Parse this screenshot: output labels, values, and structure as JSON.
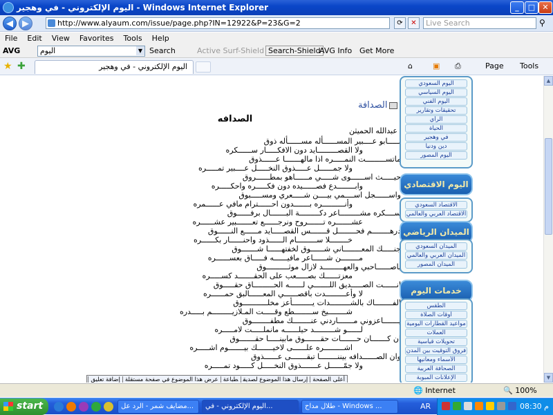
{
  "window": {
    "title": "اليوم الإلكتروني - في وهجير - Windows Internet Explorer",
    "min": "_",
    "max": "□",
    "close": "✕"
  },
  "address": {
    "back": "◀",
    "forward": "▶",
    "url": "http://www.alyaum.com/issue/page.php?IN=12922&P=23&G=2",
    "refresh": "⟳",
    "stop": "✕",
    "live_search_placeholder": "Live Search"
  },
  "menu": {
    "items": [
      "File",
      "Edit",
      "View",
      "Favorites",
      "Tools",
      "Help"
    ]
  },
  "avg": {
    "logo": "AVG",
    "search_value": "اليوم",
    "search_label": "Search",
    "active_surf": "Active Surf-Shield",
    "search_shield": "Search-Shield",
    "avg_info": "AVG Info",
    "get_more": "Get More"
  },
  "tabs": {
    "active_tab": "اليوم الإلكتروني - في وهجير",
    "page": "Page",
    "tools": "Tools"
  },
  "section": {
    "title": "الصدافة"
  },
  "article": {
    "title": "الصدافه",
    "author": "عبدالله الحميثن",
    "lines": [
      "بـــــابو عــــبير المســــــأله مســــــأله ذوق",
      "ولا القصـــــــــايد دون الافكـــــار ســــــكره",
      "ماتســـــــــت النمـــــره اذا مالهـــــــا عــــــذوق",
      "ولا جمــــــل عـــــذوق النخـــــل عــــبير تمـــــره",
      "حيـــــث اســــــوى شـــــي مــــــاهو بمطــــــروق",
      "وابــــــــدع فصــــــيده دون فكـــــره واحكـــــره",
      "واســــــجل اســــمي بيــــن شـــــعري ومســـــبوق",
      "وأنــــــــــره بـــــــدون احــــــترام مافي عــــــمره",
      "ســــكره مشـــــــــاعر دكـــــــــة البـــــــال برفــــــوق",
      "عشـــــــره تـــــــروح ونرجــــــع تعـــــــبير عشــــــره",
      "درهــــــــم فحــــــــل قـــــــس القصـــــايد مــــــع النــــــوق",
      "خــــــــلا ســـــــــام الــــــذود واحنــــــار بكــــــره",
      "جنـــــك المعــــــــاني شــــــوق لخفتهــــــا شـــــــوق",
      "مــــــــن شــــــاعر مافيــــــه فـــــاق بعســــــره",
      "باصــــــاحبي والعهـــــــــد لازال موثــــــــــوق",
      "معزتــــــك بصـــــعب على الحقـــــــد كســـــره",
      "انــــــت الصـــــديق اللـــــــي لــــــه الحـــــــــاق حقـــــوق",
      "لا وأعـــــــــدت باقصــــــي المعــــــالبق حمــــــره",
      "الفــــــــاك بالشـــــــــدات يـــــــــأعز مخلـــــــــــوق",
      "شــــــــيخ ســــــــطع وقـــــت المـلازيـــــــــم بـــــدره",
      "يـــــــاعزوني مـــــــاردني عنــــــــك مطفــــــــوق",
      "لــــــو شـــــــــد حيلــــــه مانملـــــت لامـــــره",
      "ان كـــــــان حـــــــات حقـــــــوق مابينـــــا حقـــــــوق",
      "اشـــــــــره علــــــى لاخيـــــــك بيـــــــوم اشـــــره",
      "وان الصــــــدافه بيننــــــــا تبقـــــــى عــــــذوق",
      "ولا جمّــــــل عـــــــذوق النخـــــل كـــــود تمـــــره"
    ],
    "bottom_links": [
      "أعلى الصفحة",
      "إرسال هذا الموضوع لصديق",
      "طباعة",
      "عرض هذا الموضوع في صفحة مستقلة",
      "إضافة تعليق"
    ]
  },
  "sidebar": {
    "box1": [
      "اليوم السعودي",
      "اليوم السياسي",
      "اليوم الفني",
      "تحقيقات وتقارير",
      "الرأي",
      "الحياة",
      "في وهجير",
      "دين ودنيا",
      "اليوم المصور"
    ],
    "header2": "اليوم الاقتصادي",
    "box2": [
      "الاقتصاد السعودي",
      "الاقتصاد العربي والعالمي"
    ],
    "header3": "الميدان الرياضي",
    "box3": [
      "الميدان السعودي",
      "الميدان العربي والعالمي",
      "الميدان المصور"
    ],
    "header4": "خدمات اليوم",
    "box4": [
      "الطقس",
      "أوقات الصلاة",
      "مواعيد القطارات اليومية",
      "العملات",
      "تحويلات قياسية",
      "فروق التوقيت بين المدن",
      "الأسماء ومعانيها",
      "الصحافة العربية",
      "الإعلانات المبوبة"
    ]
  },
  "status": {
    "zone": "Internet",
    "zoom": "100%"
  },
  "taskbar": {
    "start": "start",
    "tasks": [
      "مضايف شمر - الرد عل...",
      "اليوم الإلكتروني - في...",
      "طلال مداح - Windows ..."
    ],
    "lang": "AR",
    "clock": "م 08:30"
  },
  "colors": {
    "titlebar": "#0a46c8",
    "sidebar_header": "#1a5fb0",
    "taskbar": "#245edb",
    "start": "#2d8f2d"
  }
}
